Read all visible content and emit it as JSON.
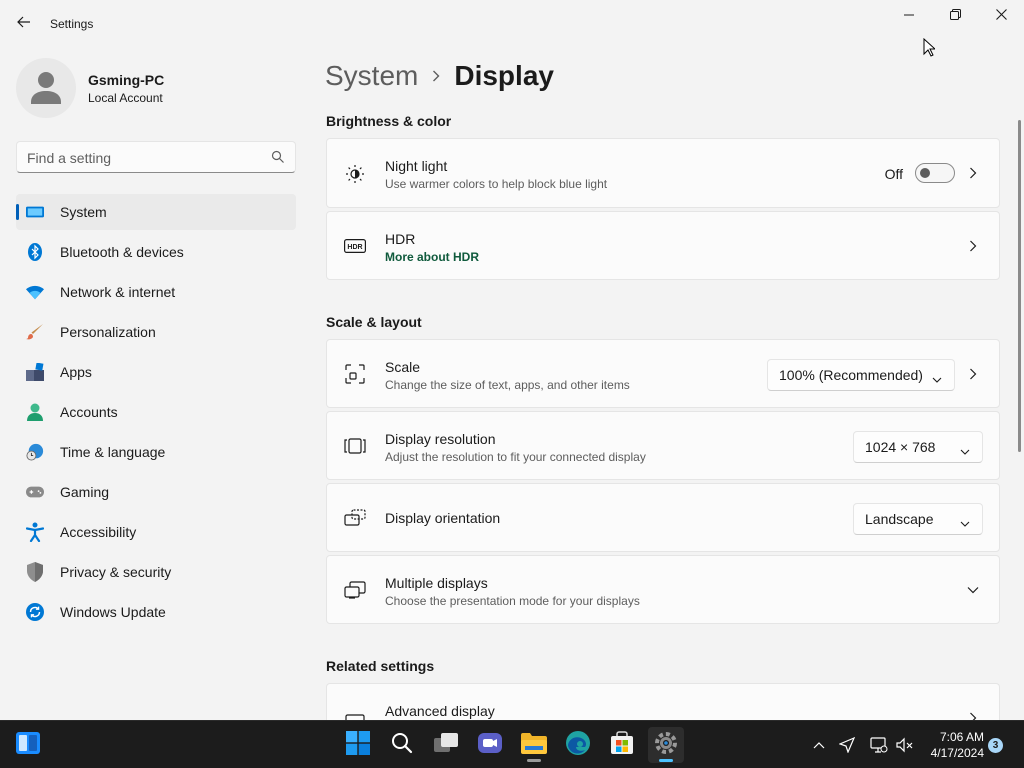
{
  "window": {
    "title": "Settings",
    "back_icon": "arrow-left-icon",
    "controls": [
      "minimize-icon",
      "maximize-icon",
      "close-icon"
    ]
  },
  "profile": {
    "name": "Gsming-PC",
    "account": "Local Account"
  },
  "search": {
    "placeholder": "Find a setting",
    "value": ""
  },
  "sidebar": {
    "items": [
      {
        "label": "System",
        "icon": "monitor-icon",
        "active": true
      },
      {
        "label": "Bluetooth & devices",
        "icon": "bluetooth-icon"
      },
      {
        "label": "Network & internet",
        "icon": "wifi-icon"
      },
      {
        "label": "Personalization",
        "icon": "paintbrush-icon"
      },
      {
        "label": "Apps",
        "icon": "apps-icon"
      },
      {
        "label": "Accounts",
        "icon": "person-icon"
      },
      {
        "label": "Time & language",
        "icon": "globe-clock-icon"
      },
      {
        "label": "Gaming",
        "icon": "gamepad-icon"
      },
      {
        "label": "Accessibility",
        "icon": "accessibility-icon"
      },
      {
        "label": "Privacy & security",
        "icon": "shield-icon"
      },
      {
        "label": "Windows Update",
        "icon": "update-icon"
      }
    ]
  },
  "breadcrumb": {
    "parent": "System",
    "current": "Display"
  },
  "sections": {
    "brightness": {
      "title": "Brightness & color",
      "night_light": {
        "title": "Night light",
        "subtitle": "Use warmer colors to help block blue light",
        "toggle_label": "Off",
        "toggle_on": false
      },
      "hdr": {
        "title": "HDR",
        "link": "More about HDR"
      }
    },
    "scale_layout": {
      "title": "Scale & layout",
      "scale": {
        "title": "Scale",
        "subtitle": "Change the size of text, apps, and other items",
        "value": "100% (Recommended)"
      },
      "resolution": {
        "title": "Display resolution",
        "subtitle": "Adjust the resolution to fit your connected display",
        "value": "1024 × 768"
      },
      "orientation": {
        "title": "Display orientation",
        "value": "Landscape"
      },
      "multiple": {
        "title": "Multiple displays",
        "subtitle": "Choose the presentation mode for your displays"
      }
    },
    "related": {
      "title": "Related settings",
      "advanced": {
        "title": "Advanced display"
      }
    }
  },
  "taskbar": {
    "apps": [
      "widgets-icon",
      "start-icon",
      "search-icon",
      "task-view-icon",
      "chat-icon",
      "file-explorer-icon",
      "edge-icon",
      "store-icon",
      "settings-icon"
    ],
    "time": "7:06 AM",
    "date": "4/17/2024",
    "notification_count": "3"
  },
  "colors": {
    "accent": "#005fb8",
    "background": "#f3f3f3",
    "card": "#fbfbfb",
    "taskbar": "#1c1c1c"
  }
}
